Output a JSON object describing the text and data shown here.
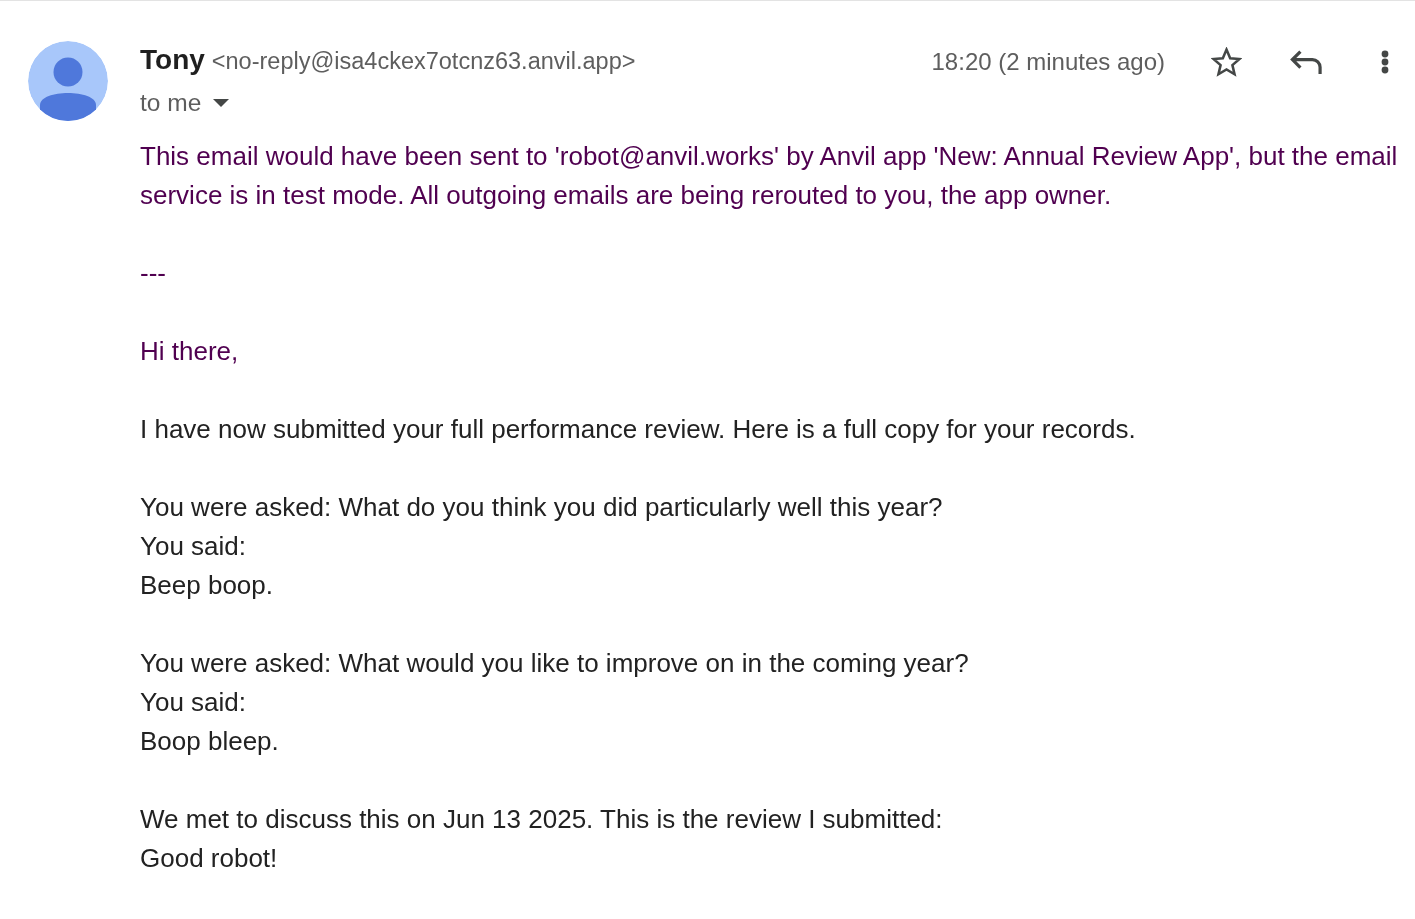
{
  "sender": {
    "name": "Tony",
    "address": "<no-reply@isa4ckex7otcnz63.anvil.app>"
  },
  "recipient": "to me",
  "time": "18:20 (2 minutes ago)",
  "starred": false,
  "body": [
    {
      "kind": "notice",
      "lines": [
        "This email would have been sent to 'robot@anvil.works' by Anvil app 'New: Annual Review App', but the email service is in test mode. All outgoing emails are being rerouted to you, the app owner."
      ]
    },
    {
      "kind": "notice",
      "lines": [
        "---"
      ]
    },
    {
      "kind": "notice",
      "lines": [
        "Hi there,"
      ]
    },
    {
      "kind": "text",
      "lines": [
        "I have now submitted your full performance review. Here is a full copy for your records."
      ]
    },
    {
      "kind": "text",
      "lines": [
        "You were asked: What do you think you did particularly well this year?",
        "You said:",
        "Beep boop."
      ]
    },
    {
      "kind": "text",
      "lines": [
        "You were asked: What would you like to improve on in the coming year?",
        "You said:",
        "Boop bleep."
      ]
    },
    {
      "kind": "text",
      "lines": [
        "We met to discuss this on Jun 13 2025. This is the review I submitted:",
        "Good robot!"
      ]
    }
  ]
}
